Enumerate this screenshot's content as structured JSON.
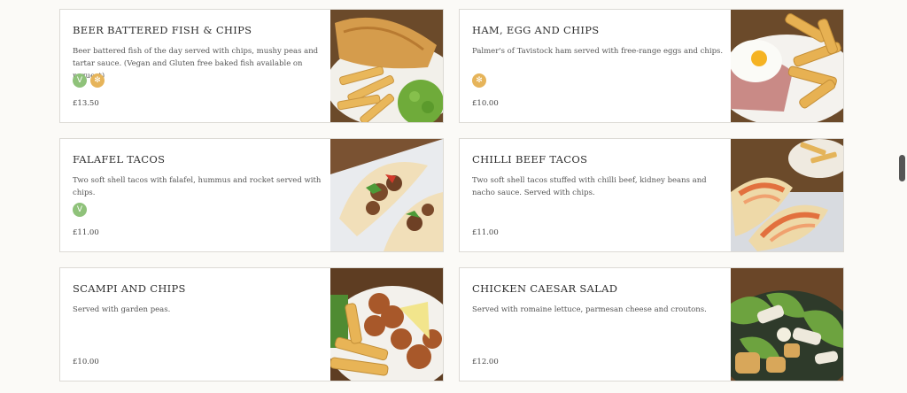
{
  "menu_items": [
    {
      "title": "BEER BATTERED FISH & CHIPS",
      "description": "Beer battered fish of the day served with chips, mushy peas and tartar sauce. (Vegan and Gluten free baked fish available on request)",
      "icons": [
        "vegan-icon",
        "gluten-free-icon"
      ],
      "price": "£13.50"
    },
    {
      "title": "HAM, EGG AND CHIPS",
      "description": "Palmer's of Tavistock ham served with free-range eggs and chips.",
      "icons": [
        "gluten-free-icon"
      ],
      "price": "£10.00"
    },
    {
      "title": "FALAFEL TACOS",
      "description": "Two soft shell tacos with falafel, hummus and rocket served with chips.",
      "icons": [
        "vegan-icon"
      ],
      "price": "£11.00"
    },
    {
      "title": "CHILLI BEEF TACOS",
      "description": "Two soft shell tacos stuffed with chilli beef, kidney beans and nacho sauce. Served with chips.",
      "icons": [],
      "price": "£11.00"
    },
    {
      "title": "SCAMPI AND CHIPS",
      "description": "Served with garden peas.",
      "icons": [],
      "price": "£10.00"
    },
    {
      "title": "CHICKEN CAESAR SALAD",
      "description": "Served with romaine lettuce, parmesan cheese and croutons.",
      "icons": [],
      "price": "£12.00"
    }
  ],
  "badges": {
    "vegan": "V",
    "gluten_free": "✻"
  },
  "colors": {
    "vegan": "#8fc27a",
    "gluten_free": "#e6b45a",
    "border": "#dcdad5"
  }
}
